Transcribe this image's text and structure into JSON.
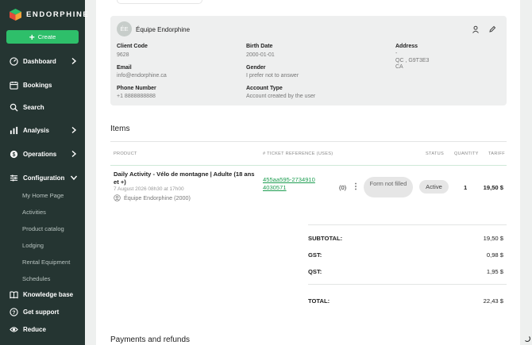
{
  "app": {
    "logo_text": "ENDORPHINE"
  },
  "sidebar": {
    "create_label": "Create",
    "nav": [
      {
        "label": "Dashboard",
        "icon": "dashboard-icon",
        "has_chevron": true
      },
      {
        "label": "Bookings",
        "icon": "calendar-icon",
        "has_chevron": false
      },
      {
        "label": "Search",
        "icon": "search-icon",
        "has_chevron": false
      },
      {
        "label": "Analysis",
        "icon": "bar-chart-icon",
        "has_chevron": true
      },
      {
        "label": "Operations",
        "icon": "dollar-icon",
        "has_chevron": true
      },
      {
        "label": "Configuration",
        "icon": "sliders-icon",
        "has_chevron": true,
        "expanded": true
      }
    ],
    "config_items": [
      "My Home Page",
      "Activities",
      "Product catalog",
      "Lodging",
      "Rental Equipment",
      "Schedules"
    ],
    "bottom": [
      {
        "label": "Knowledge base",
        "icon": "book-icon"
      },
      {
        "label": "Get support",
        "icon": "help-icon"
      },
      {
        "label": "Reduce",
        "icon": "eye-icon"
      }
    ]
  },
  "client": {
    "avatar_initials": "ÉE",
    "name": "Équipe Endorphine",
    "fields": {
      "client_code_label": "Client Code",
      "client_code": "9628",
      "birth_date_label": "Birth Date",
      "birth_date": "2000-01-01",
      "address_label": "Address",
      "address_line1": "-",
      "address_line2": "QC , G9T3E3",
      "address_line3": "CA",
      "email_label": "Email",
      "email": "info@endorphine.ca",
      "gender_label": "Gender",
      "gender": "I prefer not to answer",
      "phone_label": "Phone Number",
      "phone": "+1 8888888888",
      "account_type_label": "Account Type",
      "account_type": "Account created by the user"
    }
  },
  "items": {
    "title": "Items",
    "columns": {
      "product": "PRODUCT",
      "ticket": "# TICKET REFERENCE (USES)",
      "status": "STATUS",
      "quantity": "QUANTITY",
      "tariff": "TARIFF"
    },
    "row": {
      "title": "Daily Activity - Vélo de montagne | Adulte (18 ans et +)",
      "date": "7 August 2026 08h30 at 17h00",
      "participant": "Équipe Endorphine (2000)",
      "ticket_ref": "455aa595-27349104030571",
      "uses": "(0)",
      "form_status": "Form not filled",
      "status": "Active",
      "quantity": "1",
      "tariff": "19,50 $"
    }
  },
  "totals": {
    "subtotal_label": "SUBTOTAL:",
    "subtotal": "19,50 $",
    "gst_label": "GST:",
    "gst": "0,98 $",
    "qst_label": "QST:",
    "qst": "1,95 $",
    "total_label": "TOTAL:",
    "total": "22,43 $"
  },
  "payments": {
    "title": "Payments and refunds"
  },
  "colors": {
    "sidebar_bg": "#253532",
    "accent_green": "#2ebf6a",
    "link_green": "#1f9e52"
  }
}
